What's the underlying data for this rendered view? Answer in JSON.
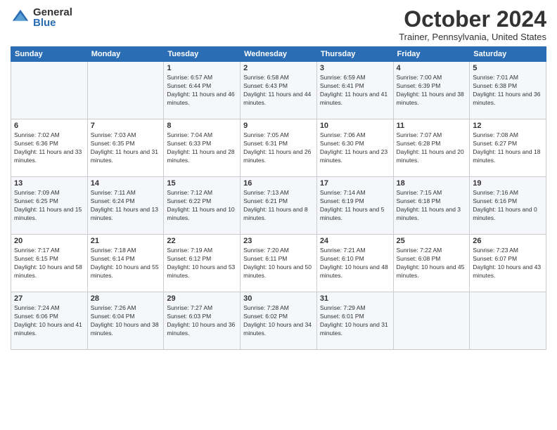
{
  "logo": {
    "general": "General",
    "blue": "Blue"
  },
  "header": {
    "month": "October 2024",
    "location": "Trainer, Pennsylvania, United States"
  },
  "weekdays": [
    "Sunday",
    "Monday",
    "Tuesday",
    "Wednesday",
    "Thursday",
    "Friday",
    "Saturday"
  ],
  "weeks": [
    [
      {
        "num": "",
        "info": ""
      },
      {
        "num": "",
        "info": ""
      },
      {
        "num": "1",
        "info": "Sunrise: 6:57 AM\nSunset: 6:44 PM\nDaylight: 11 hours and 46 minutes."
      },
      {
        "num": "2",
        "info": "Sunrise: 6:58 AM\nSunset: 6:43 PM\nDaylight: 11 hours and 44 minutes."
      },
      {
        "num": "3",
        "info": "Sunrise: 6:59 AM\nSunset: 6:41 PM\nDaylight: 11 hours and 41 minutes."
      },
      {
        "num": "4",
        "info": "Sunrise: 7:00 AM\nSunset: 6:39 PM\nDaylight: 11 hours and 38 minutes."
      },
      {
        "num": "5",
        "info": "Sunrise: 7:01 AM\nSunset: 6:38 PM\nDaylight: 11 hours and 36 minutes."
      }
    ],
    [
      {
        "num": "6",
        "info": "Sunrise: 7:02 AM\nSunset: 6:36 PM\nDaylight: 11 hours and 33 minutes."
      },
      {
        "num": "7",
        "info": "Sunrise: 7:03 AM\nSunset: 6:35 PM\nDaylight: 11 hours and 31 minutes."
      },
      {
        "num": "8",
        "info": "Sunrise: 7:04 AM\nSunset: 6:33 PM\nDaylight: 11 hours and 28 minutes."
      },
      {
        "num": "9",
        "info": "Sunrise: 7:05 AM\nSunset: 6:31 PM\nDaylight: 11 hours and 26 minutes."
      },
      {
        "num": "10",
        "info": "Sunrise: 7:06 AM\nSunset: 6:30 PM\nDaylight: 11 hours and 23 minutes."
      },
      {
        "num": "11",
        "info": "Sunrise: 7:07 AM\nSunset: 6:28 PM\nDaylight: 11 hours and 20 minutes."
      },
      {
        "num": "12",
        "info": "Sunrise: 7:08 AM\nSunset: 6:27 PM\nDaylight: 11 hours and 18 minutes."
      }
    ],
    [
      {
        "num": "13",
        "info": "Sunrise: 7:09 AM\nSunset: 6:25 PM\nDaylight: 11 hours and 15 minutes."
      },
      {
        "num": "14",
        "info": "Sunrise: 7:11 AM\nSunset: 6:24 PM\nDaylight: 11 hours and 13 minutes."
      },
      {
        "num": "15",
        "info": "Sunrise: 7:12 AM\nSunset: 6:22 PM\nDaylight: 11 hours and 10 minutes."
      },
      {
        "num": "16",
        "info": "Sunrise: 7:13 AM\nSunset: 6:21 PM\nDaylight: 11 hours and 8 minutes."
      },
      {
        "num": "17",
        "info": "Sunrise: 7:14 AM\nSunset: 6:19 PM\nDaylight: 11 hours and 5 minutes."
      },
      {
        "num": "18",
        "info": "Sunrise: 7:15 AM\nSunset: 6:18 PM\nDaylight: 11 hours and 3 minutes."
      },
      {
        "num": "19",
        "info": "Sunrise: 7:16 AM\nSunset: 6:16 PM\nDaylight: 11 hours and 0 minutes."
      }
    ],
    [
      {
        "num": "20",
        "info": "Sunrise: 7:17 AM\nSunset: 6:15 PM\nDaylight: 10 hours and 58 minutes."
      },
      {
        "num": "21",
        "info": "Sunrise: 7:18 AM\nSunset: 6:14 PM\nDaylight: 10 hours and 55 minutes."
      },
      {
        "num": "22",
        "info": "Sunrise: 7:19 AM\nSunset: 6:12 PM\nDaylight: 10 hours and 53 minutes."
      },
      {
        "num": "23",
        "info": "Sunrise: 7:20 AM\nSunset: 6:11 PM\nDaylight: 10 hours and 50 minutes."
      },
      {
        "num": "24",
        "info": "Sunrise: 7:21 AM\nSunset: 6:10 PM\nDaylight: 10 hours and 48 minutes."
      },
      {
        "num": "25",
        "info": "Sunrise: 7:22 AM\nSunset: 6:08 PM\nDaylight: 10 hours and 45 minutes."
      },
      {
        "num": "26",
        "info": "Sunrise: 7:23 AM\nSunset: 6:07 PM\nDaylight: 10 hours and 43 minutes."
      }
    ],
    [
      {
        "num": "27",
        "info": "Sunrise: 7:24 AM\nSunset: 6:06 PM\nDaylight: 10 hours and 41 minutes."
      },
      {
        "num": "28",
        "info": "Sunrise: 7:26 AM\nSunset: 6:04 PM\nDaylight: 10 hours and 38 minutes."
      },
      {
        "num": "29",
        "info": "Sunrise: 7:27 AM\nSunset: 6:03 PM\nDaylight: 10 hours and 36 minutes."
      },
      {
        "num": "30",
        "info": "Sunrise: 7:28 AM\nSunset: 6:02 PM\nDaylight: 10 hours and 34 minutes."
      },
      {
        "num": "31",
        "info": "Sunrise: 7:29 AM\nSunset: 6:01 PM\nDaylight: 10 hours and 31 minutes."
      },
      {
        "num": "",
        "info": ""
      },
      {
        "num": "",
        "info": ""
      }
    ]
  ]
}
